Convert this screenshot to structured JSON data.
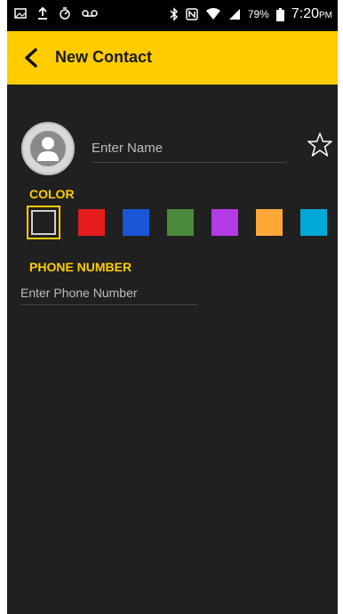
{
  "status_bar": {
    "icons_left": [
      "image-icon",
      "upload-icon",
      "stopwatch-icon",
      "voicemail-icon"
    ],
    "icons_right": [
      "bluetooth-icon",
      "nfc-icon",
      "wifi-icon",
      "signal-icon"
    ],
    "battery": "79%",
    "time": "7:20",
    "ampm": "PM"
  },
  "app_bar": {
    "title": "New Contact"
  },
  "form": {
    "name_placeholder": "Enter Name",
    "color_label": "COLOR",
    "colors": [
      "#202020",
      "#e51c1c",
      "#1a56d6",
      "#4a8a3a",
      "#b43ae6",
      "#ffa838",
      "#00a8d8"
    ],
    "selected_color_index": 0,
    "phone_label": "PHONE NUMBER",
    "phone_placeholder": "Enter Phone Number"
  }
}
